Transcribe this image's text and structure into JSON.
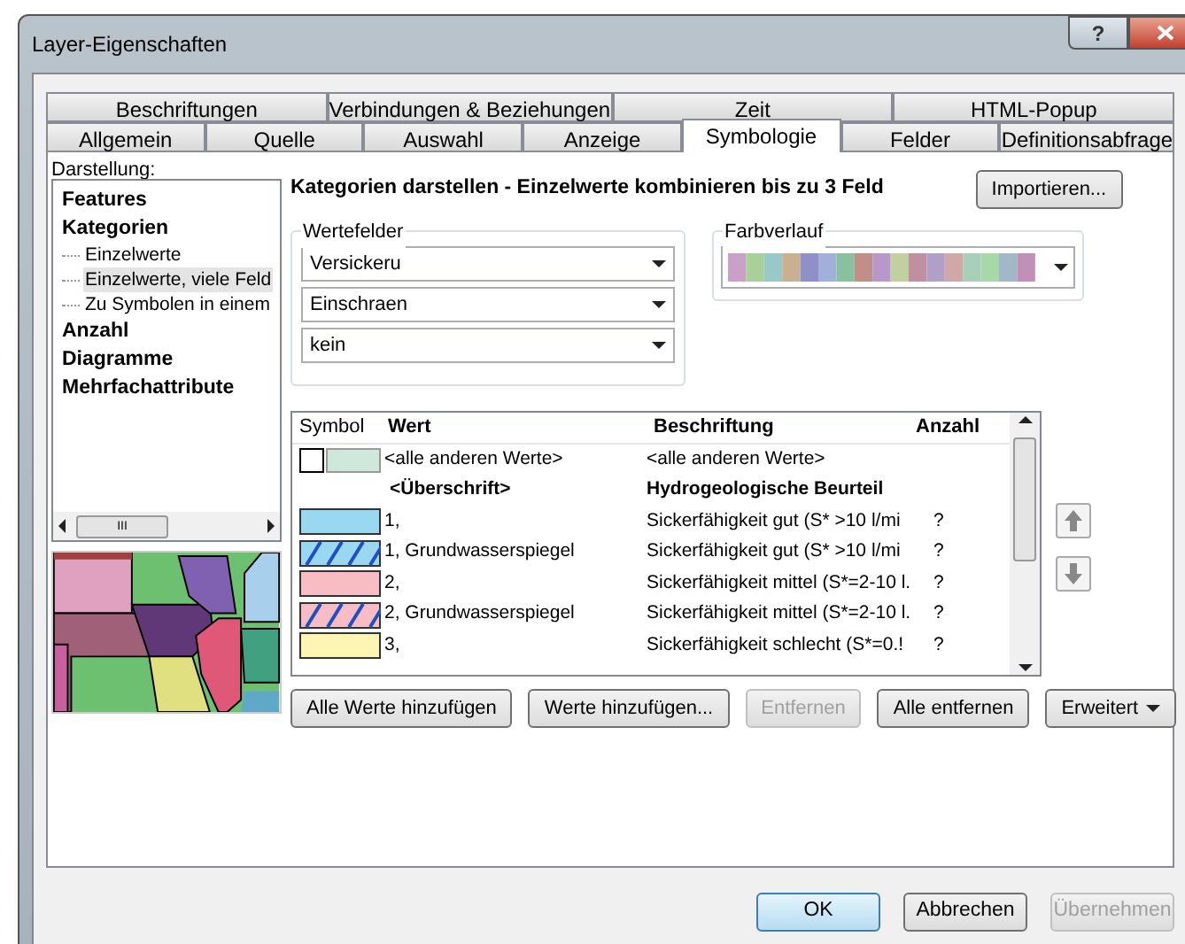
{
  "window": {
    "title": "Layer-Eigenschaften",
    "help_label": "?"
  },
  "tab_rows": [
    [
      {
        "label": "Beschriftungen",
        "selected": false
      },
      {
        "label": "Verbindungen & Beziehungen",
        "selected": false
      },
      {
        "label": "Zeit",
        "selected": false
      },
      {
        "label": "HTML-Popup",
        "selected": false
      }
    ],
    [
      {
        "label": "Allgemein",
        "selected": false
      },
      {
        "label": "Quelle",
        "selected": false
      },
      {
        "label": "Auswahl",
        "selected": false
      },
      {
        "label": "Anzeige",
        "selected": false
      },
      {
        "label": "Symbologie",
        "selected": true
      },
      {
        "label": "Felder",
        "selected": false
      },
      {
        "label": "Definitionsabfrage",
        "selected": false
      }
    ]
  ],
  "display": {
    "label": "Darstellung:",
    "items": [
      {
        "label": "Features",
        "selected": false
      },
      {
        "label": "Kategorien",
        "selected": false,
        "children": [
          {
            "label": "Einzelwerte",
            "selected": false
          },
          {
            "label": "Einzelwerte, viele Feld",
            "selected": true
          },
          {
            "label": "Zu Symbolen in einem",
            "selected": false
          }
        ]
      },
      {
        "label": "Anzahl",
        "selected": false
      },
      {
        "label": "Diagramme",
        "selected": false
      },
      {
        "label": "Mehrfachattribute",
        "selected": false
      }
    ],
    "scroll_label": "III"
  },
  "preview": {
    "kind": "picture"
  },
  "heading": "Kategorien darstellen - Einzelwerte kombinieren bis zu 3 Feld",
  "import_button": "Importieren...",
  "value_fields": {
    "label": "Wertefelder",
    "fields": [
      "Versickeru",
      "Einschraen",
      "kein"
    ]
  },
  "color_ramp": {
    "label": "Farbverlauf"
  },
  "table": {
    "columns": [
      "Symbol",
      "Wert",
      "Beschriftung",
      "Anzahl"
    ],
    "rows": [
      {
        "kind": "other",
        "value": "<alle anderen Werte>",
        "label": "<alle anderen Werte>",
        "count": ""
      },
      {
        "kind": "heading",
        "value": "<Überschrift>",
        "label": "Hydrogeologische Beurteil",
        "count": ""
      },
      {
        "kind": "value",
        "color": "#99d8f0",
        "hatched": false,
        "value": "1,",
        "label": "Sickerfähigkeit gut (S* >10 l/mi",
        "count": "?"
      },
      {
        "kind": "value",
        "color": "#99d8f0",
        "hatched": true,
        "value": "1, Grundwasserspiegel",
        "label": "Sickerfähigkeit gut (S* >10 l/mi",
        "count": "?"
      },
      {
        "kind": "value",
        "color": "#f8bcc4",
        "hatched": false,
        "value": "2,",
        "label": "Sickerfähigkeit mittel (S*=2-10 l.",
        "count": "?"
      },
      {
        "kind": "value",
        "color": "#f8bcc4",
        "hatched": true,
        "value": "2, Grundwasserspiegel",
        "label": "Sickerfähigkeit mittel (S*=2-10 l.",
        "count": "?"
      },
      {
        "kind": "value",
        "color": "#fcf5b4",
        "hatched": false,
        "value": "3,",
        "label": "Sickerfähigkeit schlecht (S*=0.!",
        "count": "?"
      }
    ]
  },
  "buttons": [
    {
      "label": "Alle Werte hinzufügen",
      "disabled": false
    },
    {
      "label": "Werte hinzufügen...",
      "disabled": false
    },
    {
      "label": "Entfernen",
      "disabled": true
    },
    {
      "label": "Alle entfernen",
      "disabled": false
    },
    {
      "label": "Erweitert",
      "disabled": false
    }
  ],
  "dialog_buttons": [
    {
      "label": "OK",
      "default": true,
      "disabled": false
    },
    {
      "label": "Abbrechen",
      "default": false,
      "disabled": false
    },
    {
      "label": "Übernehmen",
      "default": false,
      "disabled": true
    }
  ]
}
